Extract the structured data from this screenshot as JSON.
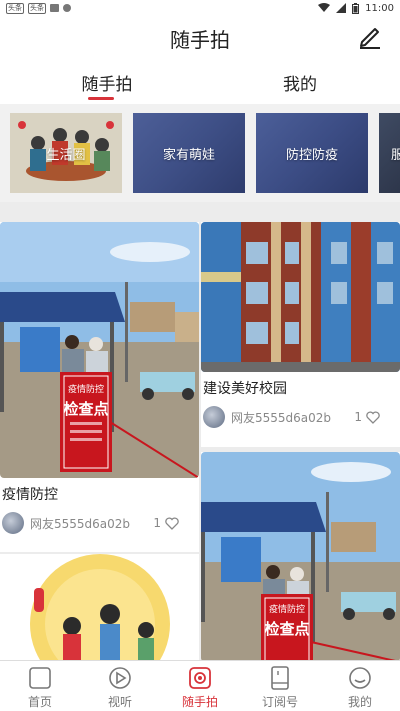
{
  "status_bar": {
    "left_chips": [
      "头条",
      "头条"
    ],
    "time": "11:00"
  },
  "header": {
    "title": "随手拍",
    "edit_icon": "pencil-icon"
  },
  "tabs": [
    {
      "label": "随手拍",
      "active": true
    },
    {
      "label": "我的",
      "active": false
    }
  ],
  "categories": [
    {
      "label": "生活圈"
    },
    {
      "label": "家有萌娃"
    },
    {
      "label": "防控防疫"
    },
    {
      "label": "服"
    }
  ],
  "feed": {
    "cards": [
      {
        "title": "疫情防控",
        "user": "网友5555d6a02b",
        "likes": "1"
      },
      {
        "title": "建设美好校园",
        "user": "网友5555d6a02b",
        "likes": "1"
      }
    ],
    "sign_text_top": "疫情防控",
    "sign_text_main": "检查点"
  },
  "bottom_nav": [
    {
      "label": "首页",
      "icon": "home-icon",
      "active": false
    },
    {
      "label": "视听",
      "icon": "play-icon",
      "active": false
    },
    {
      "label": "随手拍",
      "icon": "camera-icon",
      "active": true
    },
    {
      "label": "订阅号",
      "icon": "subscribe-icon",
      "active": false
    },
    {
      "label": "我的",
      "icon": "profile-icon",
      "active": false
    }
  ],
  "colors": {
    "accent": "#d8333a"
  }
}
